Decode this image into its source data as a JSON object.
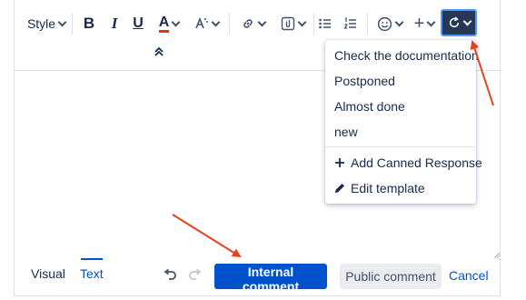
{
  "toolbar": {
    "style_label": "Style",
    "bold_label": "B",
    "italic_label": "I",
    "underline_label": "U",
    "text_color_label": "A",
    "insert_label": "+"
  },
  "canned_responses": {
    "items": [
      "Check the documentation",
      "Postponed",
      "Almost done",
      "new"
    ],
    "add_label": "Add Canned Response",
    "edit_label": "Edit template"
  },
  "footer": {
    "visual_tab": "Visual",
    "text_tab": "Text",
    "internal_comment_label": "Internal comment",
    "public_comment_label": "Public comment",
    "cancel_label": "Cancel"
  },
  "colors": {
    "primary": "#0052cc",
    "canned_button_bg": "#253858",
    "annotation_arrow": "#e8401c"
  },
  "icons": [
    "chevron-down-icon",
    "text-effects-icon",
    "link-icon",
    "attachment-icon",
    "bullet-list-icon",
    "numbered-list-icon",
    "emoji-icon",
    "canned-response-icon",
    "undo-icon",
    "redo-icon",
    "plus-icon",
    "pencil-icon",
    "double-chevron-up-icon"
  ]
}
